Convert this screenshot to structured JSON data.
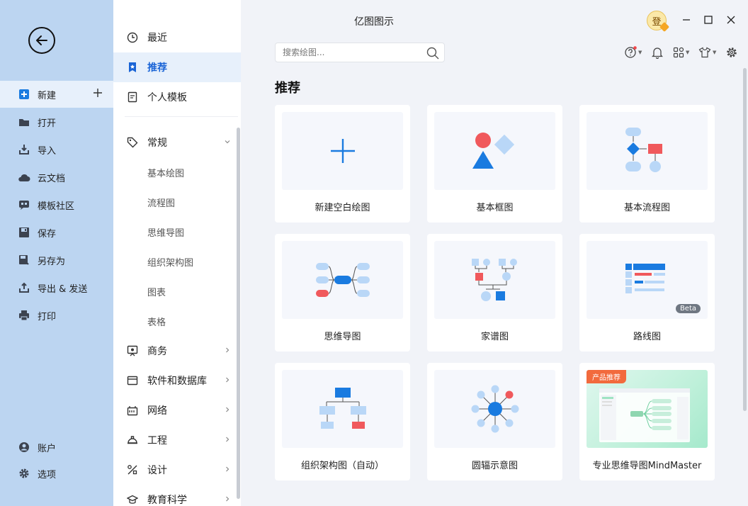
{
  "app": {
    "title": "亿图图示"
  },
  "left_bar": {
    "items": [
      {
        "label": "新建"
      },
      {
        "label": "打开"
      },
      {
        "label": "导入"
      },
      {
        "label": "云文档"
      },
      {
        "label": "模板社区"
      },
      {
        "label": "保存"
      },
      {
        "label": "另存为"
      },
      {
        "label": "导出 & 发送"
      },
      {
        "label": "打印"
      }
    ],
    "bottom": [
      {
        "label": "账户"
      },
      {
        "label": "选项"
      }
    ]
  },
  "nav2": {
    "top": [
      {
        "label": "最近"
      },
      {
        "label": "推荐"
      },
      {
        "label": "个人模板"
      }
    ],
    "general": {
      "label": "常规"
    },
    "general_sub": [
      {
        "label": "基本绘图"
      },
      {
        "label": "流程图"
      },
      {
        "label": "思维导图"
      },
      {
        "label": "组织架构图"
      },
      {
        "label": "图表"
      },
      {
        "label": "表格"
      }
    ],
    "categories": [
      {
        "label": "商务"
      },
      {
        "label": "软件和数据库"
      },
      {
        "label": "网络"
      },
      {
        "label": "工程"
      },
      {
        "label": "设计"
      },
      {
        "label": "教育科学"
      }
    ]
  },
  "header": {
    "avatar_text": "登",
    "search_placeholder": "搜索绘图..."
  },
  "main": {
    "section_title": "推荐",
    "cards": [
      {
        "label": "新建空白绘图"
      },
      {
        "label": "基本框图"
      },
      {
        "label": "基本流程图"
      },
      {
        "label": "思维导图"
      },
      {
        "label": "家谱图"
      },
      {
        "label": "路线图",
        "badge": "Beta"
      },
      {
        "label": "组织架构图（自动）"
      },
      {
        "label": "圆辐示意图"
      },
      {
        "label": "专业思维导图MindMaster",
        "badge": "产品推荐"
      }
    ]
  },
  "colors": {
    "accent": "#1a64d6",
    "sidebar": "#bcd5f1",
    "red": "#f0595c",
    "light_blue": "#b9d7f7"
  }
}
